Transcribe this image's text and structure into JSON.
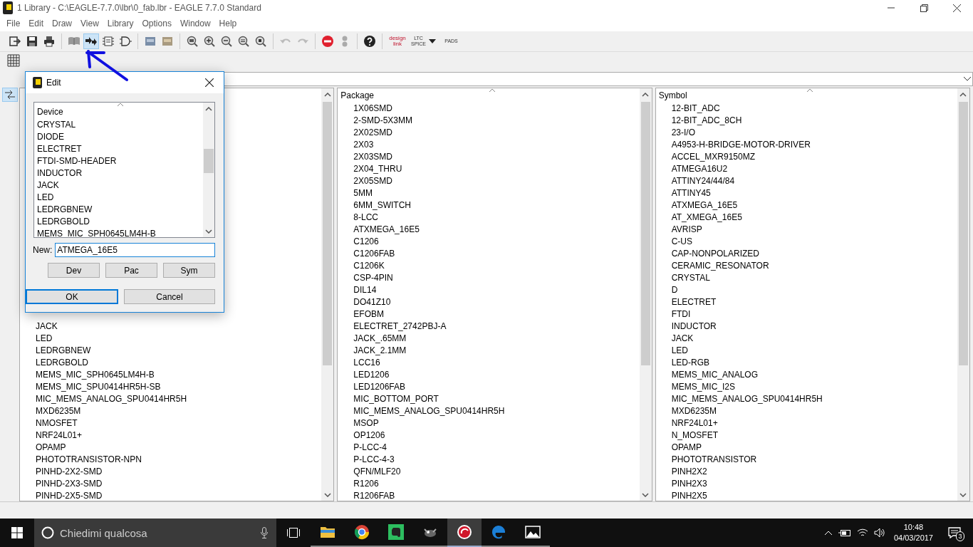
{
  "window": {
    "title": "1 Library - C:\\EAGLE-7.7.0\\lbr\\0_fab.lbr - EAGLE 7.7.0 Standard"
  },
  "menu": [
    "File",
    "Edit",
    "Draw",
    "View",
    "Library",
    "Options",
    "Window",
    "Help"
  ],
  "toolbar": [
    {
      "kind": "open",
      "selected": false
    },
    {
      "kind": "save",
      "selected": false
    },
    {
      "kind": "print",
      "selected": false
    },
    {
      "kind": "sep"
    },
    {
      "kind": "book",
      "selected": false
    },
    {
      "kind": "use",
      "selected": true
    },
    {
      "kind": "chip",
      "selected": false
    },
    {
      "kind": "gate",
      "selected": false
    },
    {
      "kind": "sep"
    },
    {
      "kind": "image",
      "selected": false
    },
    {
      "kind": "image2",
      "selected": false
    },
    {
      "kind": "sep"
    },
    {
      "kind": "zoomfit",
      "selected": false
    },
    {
      "kind": "zoomin",
      "selected": false
    },
    {
      "kind": "zoomout",
      "selected": false
    },
    {
      "kind": "zoomredraw",
      "selected": false
    },
    {
      "kind": "zoomselect",
      "selected": false
    },
    {
      "kind": "sep"
    },
    {
      "kind": "undo",
      "selected": false
    },
    {
      "kind": "redo",
      "selected": false
    },
    {
      "kind": "sep"
    },
    {
      "kind": "stop",
      "selected": false
    },
    {
      "kind": "dots",
      "selected": false
    },
    {
      "kind": "sep"
    },
    {
      "kind": "help",
      "selected": false
    },
    {
      "kind": "sep"
    }
  ],
  "logo_buttons": [
    {
      "kind": "designlink",
      "texts": [
        "design",
        "link"
      ]
    },
    {
      "kind": "ltspice",
      "texts": [
        "LTC",
        "SPICE"
      ]
    },
    {
      "kind": "pads",
      "texts": [
        "PADS"
      ]
    }
  ],
  "panels": [
    {
      "items": [
        "JACK",
        "LED",
        "LEDRGBNEW",
        "LEDRGBOLD",
        "MEMS_MIC_SPH0645LM4H-B",
        "MEMS_MIC_SPU0414HR5H-SB",
        "MIC_MEMS_ANALOG_SPU0414HR5H",
        "MXD6235M",
        "NMOSFET",
        "NRF24L01+",
        "OPAMP",
        "PHOTOTRANSISTOR-NPN",
        "PINHD-2X2-SMD",
        "PINHD-2X3-SMD",
        "PINHD-2X5-SMD"
      ]
    },
    {
      "header": "Package",
      "items": [
        "1X06SMD",
        "2-SMD-5X3MM",
        "2X02SMD",
        "2X03",
        "2X03SMD",
        "2X04_THRU",
        "2X05SMD",
        "5MM",
        "6MM_SWITCH",
        "8-LCC",
        "ATXMEGA_16E5",
        "C1206",
        "C1206FAB",
        "C1206K",
        "CSP-4PIN",
        "DIL14",
        "DO41Z10",
        "EFOBM",
        "ELECTRET_2742PBJ-A",
        "JACK_.65MM",
        "JACK_2.1MM",
        "LCC16",
        "LED1206",
        "LED1206FAB",
        "MIC_BOTTOM_PORT",
        "MIC_MEMS_ANALOG_SPU0414HR5H",
        "MSOP",
        "OP1206",
        "P-LCC-4",
        "P-LCC-4-3",
        "QFN/MLF20",
        "R1206",
        "R1206FAB"
      ]
    },
    {
      "header": "Symbol",
      "items": [
        "12-BIT_ADC",
        "12-BIT_ADC_8CH",
        "23-I/O",
        "A4953-H-BRIDGE-MOTOR-DRIVER",
        "ACCEL_MXR9150MZ",
        "ATMEGA16U2",
        "ATTINY24/44/84",
        "ATTINY45",
        "ATXMEGA_16E5",
        "AT_XMEGA_16E5",
        "AVRISP",
        "C-US",
        "CAP-NONPOLARIZED",
        "CERAMIC_RESONATOR",
        "CRYSTAL",
        "D",
        "ELECTRET",
        "FTDI",
        "INDUCTOR",
        "JACK",
        "LED",
        "LED-RGB",
        "MEMS_MIC_ANALOG",
        "MEMS_MIC_I2S",
        "MIC_MEMS_ANALOG_SPU0414HR5H",
        "MXD6235M",
        "NRF24L01+",
        "N_MOSFET",
        "OPAMP",
        "PHOTOTRANSISTOR",
        "PINH2X2",
        "PINH2X3",
        "PINH2X5"
      ]
    }
  ],
  "dialog": {
    "title": "Edit",
    "list_header": "Device",
    "items": [
      "CRYSTAL",
      "DIODE",
      "ELECTRET",
      "FTDI-SMD-HEADER",
      "INDUCTOR",
      "JACK",
      "LED",
      "LEDRGBNEW",
      "LEDRGBOLD",
      "MEMS_MIC_SPH0645LM4H-B"
    ],
    "new_label": "New:",
    "new_value": "ATMEGA_16E5",
    "type_buttons": [
      "Dev",
      "Pac",
      "Sym"
    ],
    "ok": "OK",
    "cancel": "Cancel"
  },
  "taskbar": {
    "search_placeholder": "Chiedimi qualcosa",
    "apps": [
      {
        "kind": "folder",
        "selected": false
      },
      {
        "kind": "browser",
        "selected": false
      },
      {
        "kind": "note",
        "selected": false
      },
      {
        "kind": "gimp",
        "selected": false
      },
      {
        "kind": "eagle",
        "selected": true
      },
      {
        "kind": "edge",
        "selected": false
      },
      {
        "kind": "photos",
        "selected": false
      }
    ],
    "time": "10:48",
    "date": "04/03/2017",
    "notifications": "3"
  }
}
